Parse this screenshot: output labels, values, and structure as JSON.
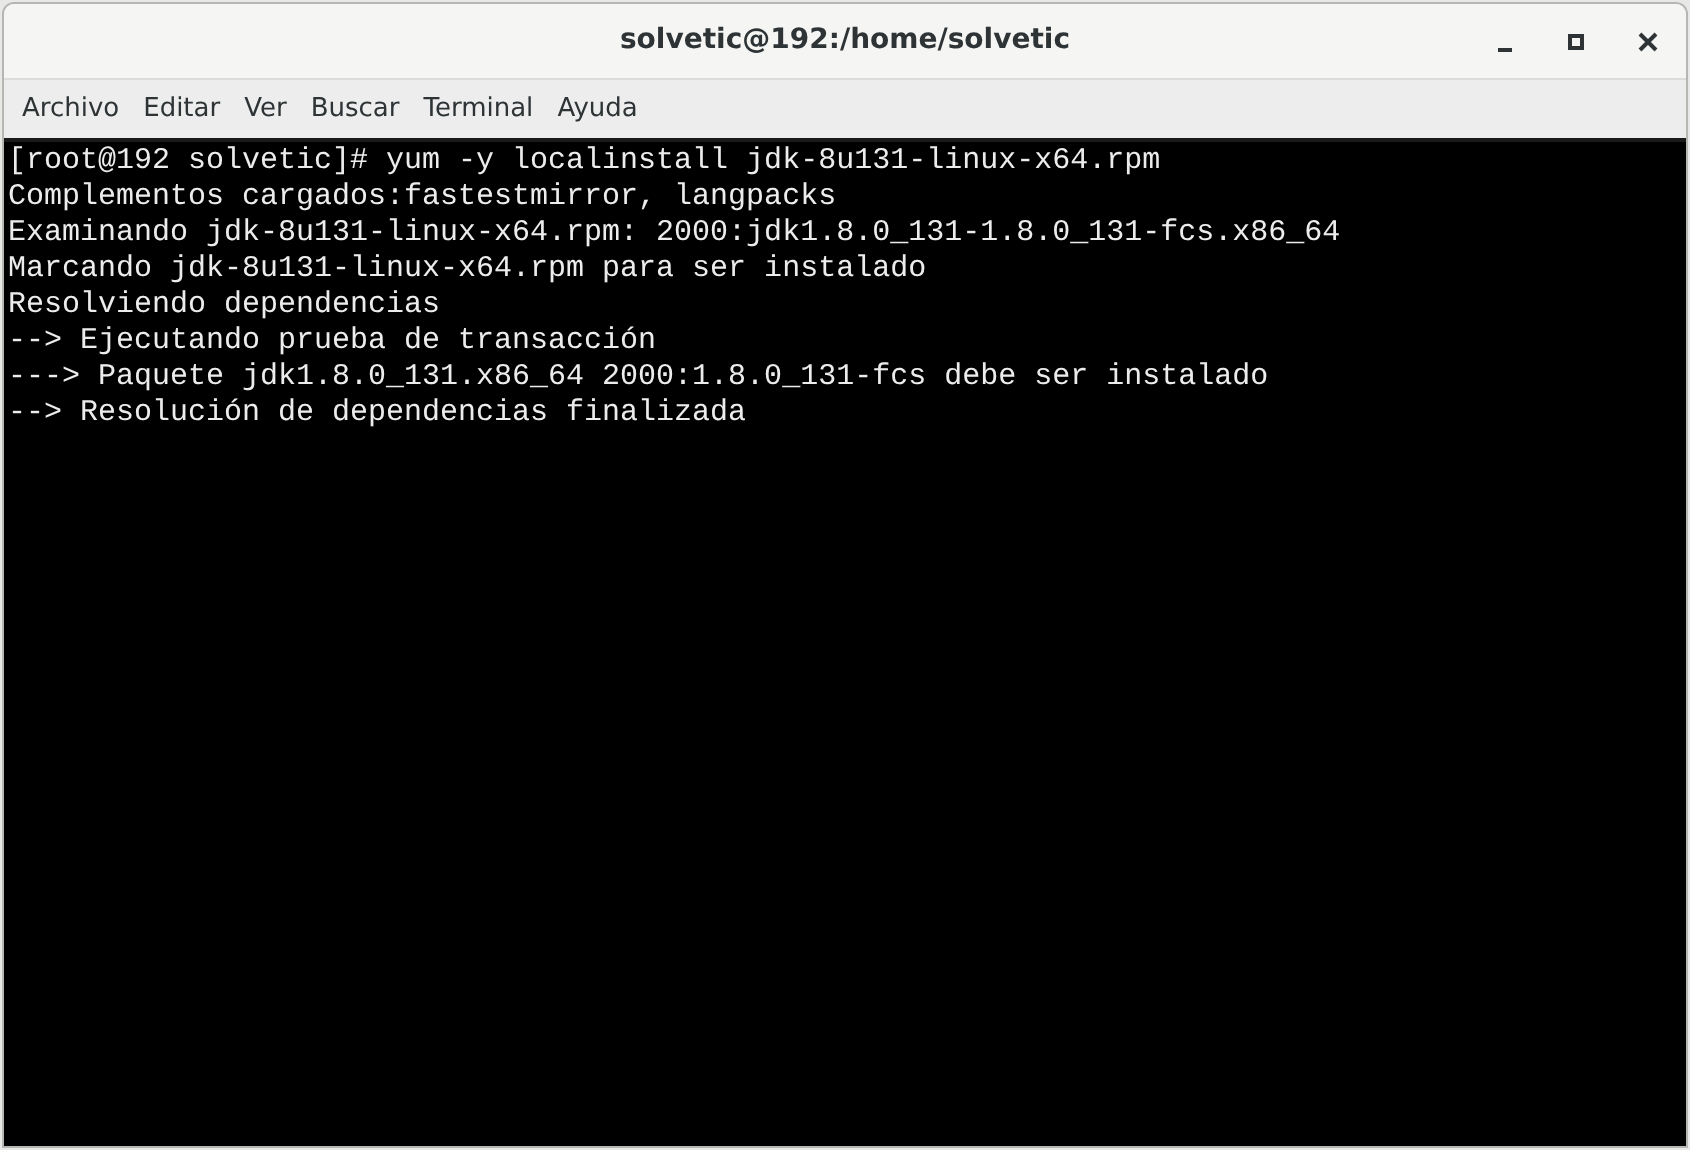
{
  "window": {
    "title": "solvetic@192:/home/solvetic"
  },
  "menu": [
    "Archivo",
    "Editar",
    "Ver",
    "Buscar",
    "Terminal",
    "Ayuda"
  ],
  "terminal": {
    "lines": [
      "[root@192 solvetic]# yum -y localinstall jdk-8u131-linux-x64.rpm",
      "Complementos cargados:fastestmirror, langpacks",
      "Examinando jdk-8u131-linux-x64.rpm: 2000:jdk1.8.0_131-1.8.0_131-fcs.x86_64",
      "Marcando jdk-8u131-linux-x64.rpm para ser instalado",
      "Resolviendo dependencias",
      "--> Ejecutando prueba de transacción",
      "---> Paquete jdk1.8.0_131.x86_64 2000:1.8.0_131-fcs debe ser instalado",
      "--> Resolución de dependencias finalizada"
    ]
  }
}
